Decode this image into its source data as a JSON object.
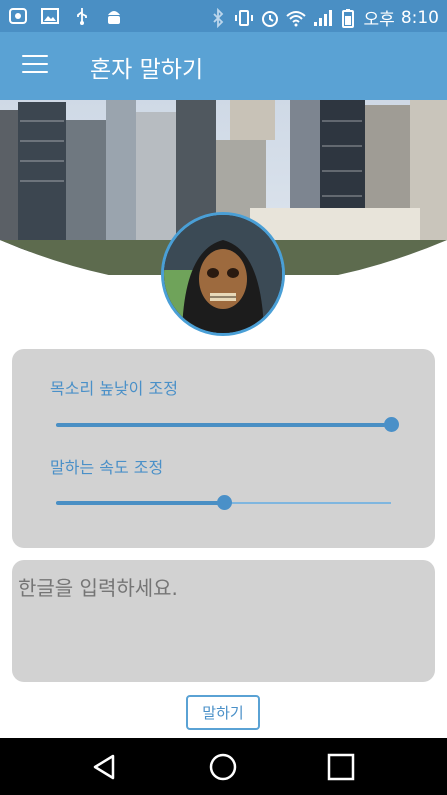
{
  "status_bar": {
    "left_icons": [
      "app-notification-icon",
      "image-icon",
      "usb-icon",
      "android-debug-icon"
    ],
    "right_icons": [
      "bluetooth-icon",
      "vibrate-icon",
      "alarm-icon",
      "wifi-icon",
      "signal-icon",
      "battery-icon"
    ],
    "ampm": "오후",
    "time": "8:10"
  },
  "app_bar": {
    "menu_icon": "hamburger-menu-icon",
    "title": "혼자 말하기"
  },
  "sliders": [
    {
      "label": "목소리 높낮이 조정",
      "value": 1.0
    },
    {
      "label": "말하는 속도 조정",
      "value": 0.5
    }
  ],
  "input": {
    "placeholder": "한글을 입력하세요."
  },
  "speak_button": {
    "label": "말하기"
  },
  "nav_bar": {
    "icons": [
      "back-icon",
      "home-icon",
      "recents-icon"
    ]
  },
  "colors": {
    "status_bar": "#4a8fc4",
    "app_bar": "#5aa2d4",
    "accent": "#4a90c8",
    "card": "#d2d2d2"
  }
}
